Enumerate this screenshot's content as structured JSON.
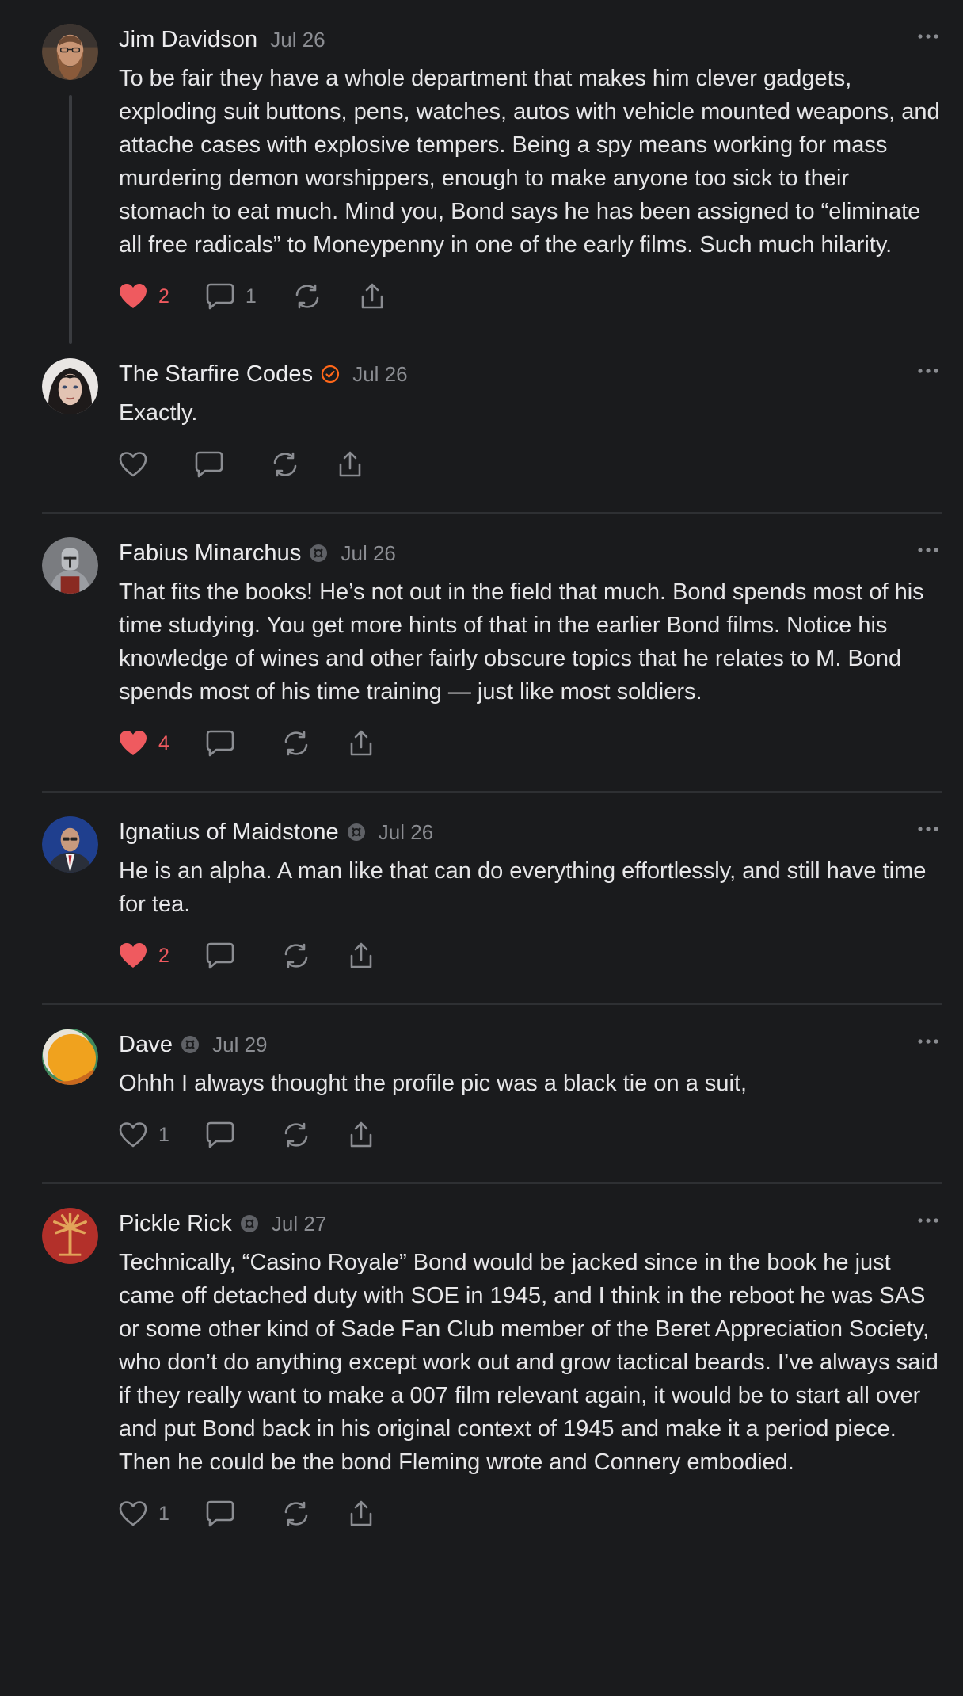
{
  "colors": {
    "background": "#1a1b1d",
    "text": "#e6e6e8",
    "muted": "#8b8d92",
    "liked": "#ef5a5f",
    "verified": "#ff6719",
    "separator": "#2e3033"
  },
  "comments": [
    {
      "author": "Jim Davidson",
      "date": "Jul 26",
      "badge": "none",
      "avatar": "bearded-man-avatar",
      "body": "To be fair they have a whole department that makes him clever gadgets, exploding suit buttons, pens, watches, autos with vehicle mounted weapons, and attache cases with explosive tempers. Being a spy means working for mass murdering demon worshippers, enough to make anyone too sick to their stomach to eat much. Mind you, Bond says he has been assigned to “eliminate all free radicals” to Moneypenny in one of the early films. Such much hilarity.",
      "liked": true,
      "likes": "2",
      "replies": "1"
    },
    {
      "author": "The Starfire Codes",
      "date": "Jul 26",
      "badge": "verified",
      "avatar": "woman-portrait-avatar",
      "body": "Exactly.",
      "liked": false,
      "likes": "",
      "replies": ""
    },
    {
      "author": "Fabius Minarchus",
      "date": "Jul 26",
      "badge": "subscriber",
      "avatar": "armored-knight-avatar",
      "body": "That fits the books! He’s not out in the field that much. Bond spends most of his time studying. You get more hints of that in the earlier Bond films. Notice his knowledge of wines and other fairly obscure topics that he relates to M. Bond spends most of his time training — just like most soldiers.",
      "liked": true,
      "likes": "4",
      "replies": ""
    },
    {
      "author": "Ignatius of Maidstone",
      "date": "Jul 26",
      "badge": "subscriber",
      "avatar": "cartoon-man-avatar",
      "body": "He is an alpha. A man like that can do everything effortlessly, and still have time for tea.",
      "liked": true,
      "likes": "2",
      "replies": ""
    },
    {
      "author": "Dave",
      "date": "Jul 29",
      "badge": "subscriber",
      "avatar": "orange-circle-avatar",
      "body": "Ohhh I always thought the profile pic was a black tie on a suit,",
      "liked": false,
      "likes": "1",
      "replies": ""
    },
    {
      "author": "Pickle Rick",
      "date": "Jul 27",
      "badge": "subscriber",
      "avatar": "palm-tree-seal-avatar",
      "body": "Technically, “Casino Royale” Bond would be jacked since in the book he just came off detached duty with SOE in 1945, and I think in the reboot he was SAS or some other kind of Sade Fan Club member of the Beret Appreciation Society, who don’t do anything except work out and grow tactical beards. I’ve always said if they really want to make a 007 film relevant again, it would be to start all over and put Bond back in his original context of 1945 and make it a period piece. Then he could be the bond Fleming wrote and Connery embodied.",
      "liked": false,
      "likes": "1",
      "replies": ""
    }
  ]
}
